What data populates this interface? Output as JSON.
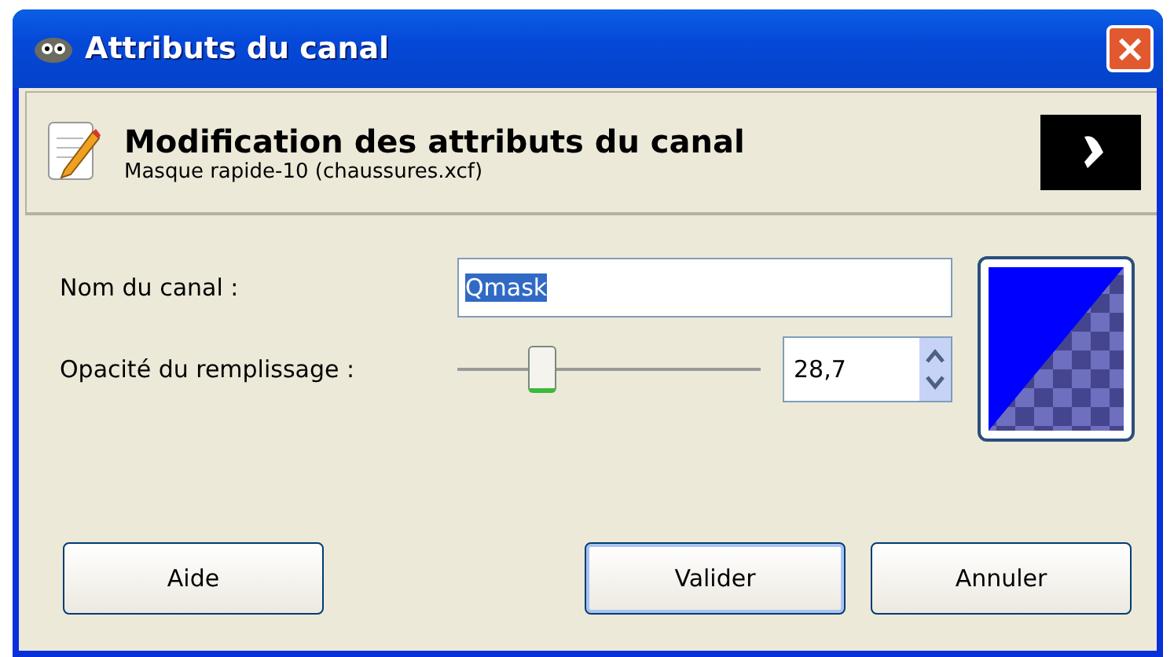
{
  "window": {
    "title": "Attributs du canal",
    "close": "×"
  },
  "header": {
    "title": "Modification des attributs du canal",
    "subtitle": "Masque rapide-10 (chaussures.xcf)"
  },
  "fields": [
    {
      "kind": "text",
      "label": "Nom du canal :",
      "value": "Qmask",
      "selected": true
    },
    {
      "kind": "slider",
      "label": "Opacité du remplissage :",
      "level": 0.287,
      "value": "28,7"
    }
  ],
  "buttons": [
    {
      "label": "Aide",
      "focused": false
    },
    {
      "label": "Valider",
      "focused": true
    },
    {
      "label": "Annuler",
      "focused": false
    }
  ]
}
